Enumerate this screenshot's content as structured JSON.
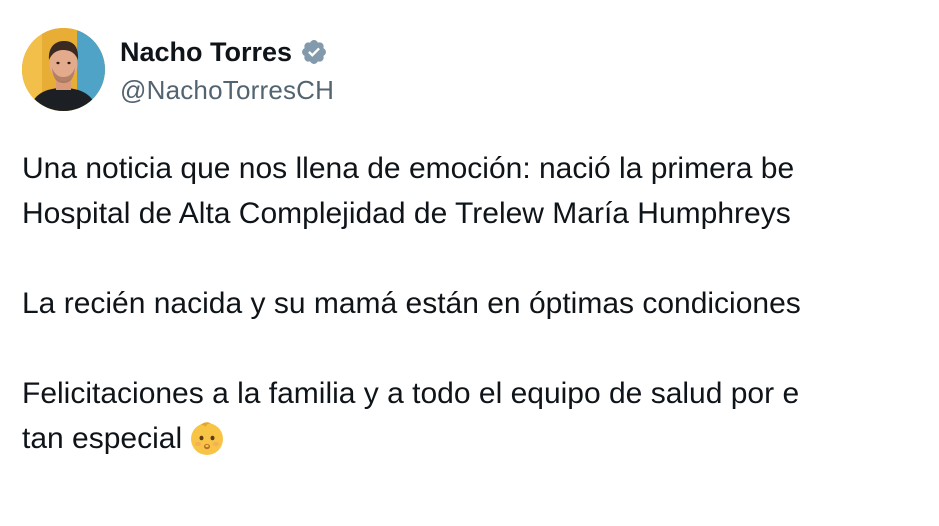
{
  "author": {
    "name": "Nacho Torres",
    "handle": "@NachoTorresCH",
    "verified": true,
    "verified_icon": "verified-badge-icon",
    "verified_color": "#829aab"
  },
  "tweet": {
    "line_1": "Una noticia que nos llena de emoción: nació la primera be",
    "line_2": "Hospital de Alta Complejidad de Trelew María Humphreys",
    "line_3": "La recién nacida y su mamá están en óptimas condiciones",
    "line_4": "Felicitaciones a la familia y a todo el equipo de salud por e",
    "line_5": "tan especial",
    "emoji": "baby-face-emoji"
  },
  "colors": {
    "text": "#0f1419",
    "secondary_text": "#536471",
    "background": "#ffffff",
    "avatar_background": "#e4a933"
  }
}
